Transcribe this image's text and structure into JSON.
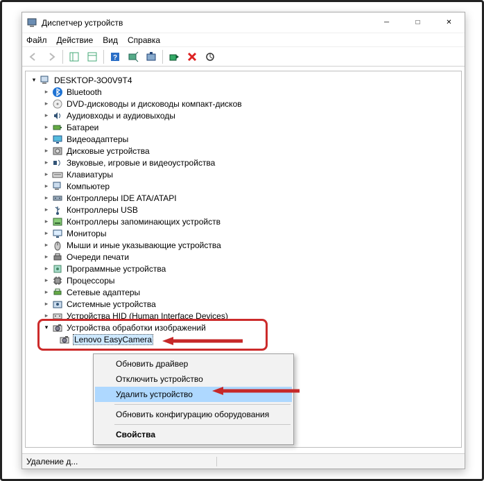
{
  "window": {
    "title": "Диспетчер устройств",
    "status": "Удаление д..."
  },
  "menus": [
    "Файл",
    "Действие",
    "Вид",
    "Справка"
  ],
  "root": {
    "label": "DESKTOP-3O0V9T4"
  },
  "devices": [
    {
      "label": "Bluetooth",
      "svg": "bluetooth"
    },
    {
      "label": "DVD-дисководы и дисководы компакт-дисков",
      "svg": "disc"
    },
    {
      "label": "Аудиовходы и аудиовыходы",
      "svg": "audio"
    },
    {
      "label": "Батареи",
      "svg": "battery"
    },
    {
      "label": "Видеоадаптеры",
      "svg": "display"
    },
    {
      "label": "Дисковые устройства",
      "svg": "hdd"
    },
    {
      "label": "Звуковые, игровые и видеоустройства",
      "svg": "sound"
    },
    {
      "label": "Клавиатуры",
      "svg": "keyboard"
    },
    {
      "label": "Компьютер",
      "svg": "computer"
    },
    {
      "label": "Контроллеры IDE ATA/ATAPI",
      "svg": "ide"
    },
    {
      "label": "Контроллеры USB",
      "svg": "usb"
    },
    {
      "label": "Контроллеры запоминающих устройств",
      "svg": "storage"
    },
    {
      "label": "Мониторы",
      "svg": "monitor"
    },
    {
      "label": "Мыши и иные указывающие устройства",
      "svg": "mouse"
    },
    {
      "label": "Очереди печати",
      "svg": "printer"
    },
    {
      "label": "Программные устройства",
      "svg": "soft"
    },
    {
      "label": "Процессоры",
      "svg": "cpu"
    },
    {
      "label": "Сетевые адаптеры",
      "svg": "net"
    },
    {
      "label": "Системные устройства",
      "svg": "system"
    },
    {
      "label": "Устройства HID (Human Interface Devices)",
      "svg": "hid"
    }
  ],
  "imaging": {
    "category": "Устройства обработки изображений",
    "device": "Lenovo EasyCamera"
  },
  "contextMenu": {
    "items": [
      {
        "label": "Обновить драйвер",
        "highlight": false
      },
      {
        "label": "Отключить устройство",
        "highlight": false
      },
      {
        "label": "Удалить устройство",
        "highlight": true
      }
    ],
    "item4": "Обновить конфигурацию оборудования",
    "item5": "Свойства"
  }
}
